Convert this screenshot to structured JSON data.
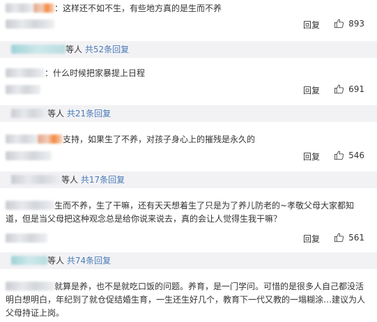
{
  "comments": [
    {
      "text": "：这样还不如不生，有些地方真的是生而不养",
      "reply": "回复",
      "likes": "893"
    },
    {
      "text": "：什么时候把家暴提上日程",
      "reply": "回复",
      "likes": "691"
    },
    {
      "text": "支持，如果生了不养，对孩子身心上的摧残是永久的",
      "reply": "回复",
      "likes": "546"
    },
    {
      "text": "生而不养，生了干嘛，还有天天想着生了只是为了养儿防老的~孝敬父母大家都知道，但是当父母把这种观念总是给你说来说去，真的会让人觉得生我干嘛？",
      "reply": "回复",
      "likes": "561"
    },
    {
      "text": "就算是养，也不是就吃口饭的问题。养育，是一门学问。可惜的是很多人自己都没活明白想明白，年纪到了就仓促结婚生育，一生还生好几个，教育下一代又教的一塌糊涂…建议为人父母持证上岗。"
    }
  ],
  "threads": [
    {
      "suffix": "等人",
      "link": "共52条回复"
    },
    {
      "suffix": "等人",
      "link": "共21条回复"
    },
    {
      "suffix": "等人",
      "link": "共17条回复"
    },
    {
      "suffix": "等人",
      "link": "共74条回复"
    }
  ],
  "colors": {
    "link": "#4a7ab5",
    "thread_bg": "#f2f2f5",
    "text": "#333333"
  },
  "icons": {
    "like": "thumbs-up-icon"
  }
}
